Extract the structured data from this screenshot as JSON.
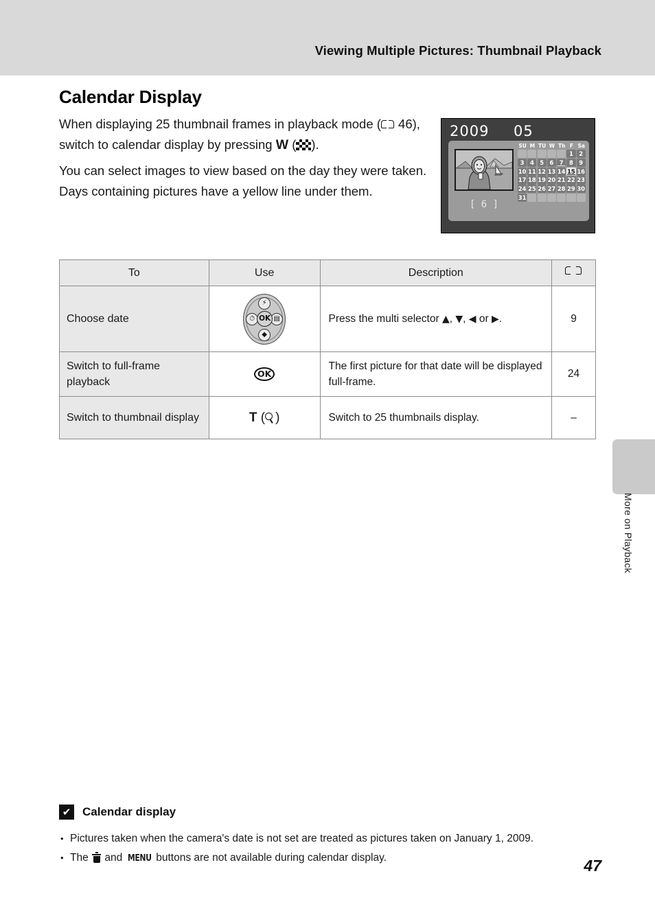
{
  "header": {
    "running_title": "Viewing Multiple Pictures: Thumbnail Playback"
  },
  "page_title": "Calendar Display",
  "intro": {
    "para1_a": "When displaying 25 thumbnail frames in playback mode (",
    "para1_ref": "46), switch to calendar display by pressing ",
    "para1_w": "W",
    "para1_end": ").",
    "para2": "You can select images to view based on the day they were taken. Days containing pictures have a yellow line under them."
  },
  "monitor": {
    "year": "2009",
    "month": "05",
    "count": "[  6 ]",
    "dow": [
      "SU",
      "M",
      "TU",
      "W",
      "Th",
      "F",
      "Sa"
    ],
    "weeks": [
      [
        {
          "label": "",
          "state": "empty"
        },
        {
          "label": "",
          "state": "empty"
        },
        {
          "label": "",
          "state": "empty"
        },
        {
          "label": "",
          "state": "empty"
        },
        {
          "label": "",
          "state": "empty"
        },
        {
          "label": "1",
          "state": "day"
        },
        {
          "label": "2",
          "state": "day"
        }
      ],
      [
        {
          "label": "3",
          "state": "day"
        },
        {
          "label": "4",
          "state": "day"
        },
        {
          "label": "5",
          "state": "day"
        },
        {
          "label": "6",
          "state": "day"
        },
        {
          "label": "7",
          "state": "day has-pic"
        },
        {
          "label": "8",
          "state": "day"
        },
        {
          "label": "9",
          "state": "day"
        }
      ],
      [
        {
          "label": "10",
          "state": "day"
        },
        {
          "label": "11",
          "state": "day"
        },
        {
          "label": "12",
          "state": "day"
        },
        {
          "label": "13",
          "state": "day"
        },
        {
          "label": "14",
          "state": "day"
        },
        {
          "label": "15",
          "state": "day selected has-pic"
        },
        {
          "label": "16",
          "state": "day"
        }
      ],
      [
        {
          "label": "17",
          "state": "day"
        },
        {
          "label": "18",
          "state": "day"
        },
        {
          "label": "19",
          "state": "day"
        },
        {
          "label": "20",
          "state": "day"
        },
        {
          "label": "21",
          "state": "day"
        },
        {
          "label": "22",
          "state": "day"
        },
        {
          "label": "23",
          "state": "day"
        }
      ],
      [
        {
          "label": "24",
          "state": "day"
        },
        {
          "label": "25",
          "state": "day"
        },
        {
          "label": "26",
          "state": "day"
        },
        {
          "label": "27",
          "state": "day"
        },
        {
          "label": "28",
          "state": "day"
        },
        {
          "label": "29",
          "state": "day"
        },
        {
          "label": "30",
          "state": "day"
        }
      ],
      [
        {
          "label": "31",
          "state": "day"
        },
        {
          "label": "",
          "state": "empty"
        },
        {
          "label": "",
          "state": "empty"
        },
        {
          "label": "",
          "state": "empty"
        },
        {
          "label": "",
          "state": "empty"
        },
        {
          "label": "",
          "state": "empty"
        },
        {
          "label": "",
          "state": "empty"
        }
      ]
    ]
  },
  "table": {
    "headers": {
      "to": "To",
      "use": "Use",
      "description": "Description",
      "ref": "book-icon"
    },
    "rows": [
      {
        "to": "Choose date",
        "use_icon": "multi-selector",
        "desc_a": "Press the multi selector ",
        "desc_up": "▲",
        "desc_sep1": ", ",
        "desc_down": "▼",
        "desc_sep2": ", ",
        "desc_left": "◀",
        "desc_or": " or ",
        "desc_right": "▶",
        "desc_end": ".",
        "ref": "9"
      },
      {
        "to": "Switch to full-frame playback",
        "use_label": "OK",
        "desc": "The first picture for that date will be displayed full-frame.",
        "ref": "24"
      },
      {
        "to": "Switch to thumbnail display",
        "use_label": "T",
        "desc": "Switch to 25 thumbnails display.",
        "ref": "–"
      }
    ]
  },
  "side_tab": {
    "label": "More on Playback"
  },
  "note": {
    "mark": "✔",
    "title": "Calendar display",
    "bullet1": "Pictures taken when the camera's date is not set are treated as pictures taken on January 1, 2009.",
    "bullet2_a": "The ",
    "bullet2_menu": "MENU",
    "bullet2_and": " and ",
    "bullet2_end": " buttons are not available during calendar display."
  },
  "page_number": "47"
}
